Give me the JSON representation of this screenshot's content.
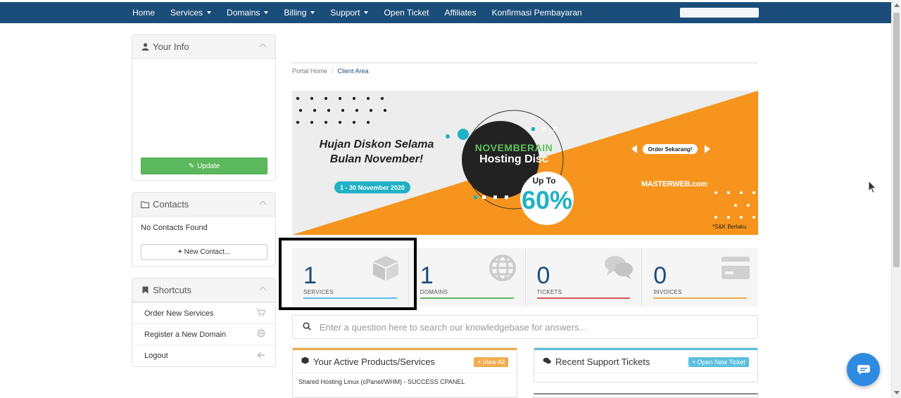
{
  "nav": {
    "items": [
      {
        "label": "Home",
        "dropdown": false
      },
      {
        "label": "Services",
        "dropdown": true
      },
      {
        "label": "Domains",
        "dropdown": true
      },
      {
        "label": "Billing",
        "dropdown": true
      },
      {
        "label": "Support",
        "dropdown": true
      },
      {
        "label": "Open Ticket",
        "dropdown": false
      },
      {
        "label": "Affiliates",
        "dropdown": false
      },
      {
        "label": "Konfirmasi Pembayaran",
        "dropdown": false
      }
    ]
  },
  "sidebar": {
    "your_info": {
      "title": "Your Info",
      "icon": "user-icon",
      "update_label": "Update"
    },
    "contacts": {
      "title": "Contacts",
      "icon": "folder-icon",
      "empty_text": "No Contacts Found",
      "new_label": "New Contact..."
    },
    "shortcuts": {
      "title": "Shortcuts",
      "icon": "bookmark-icon",
      "items": [
        {
          "label": "Order New Services",
          "icon": "cart-icon"
        },
        {
          "label": "Register a New Domain",
          "icon": "globe-icon"
        },
        {
          "label": "Logout",
          "icon": "arrow-left-icon"
        }
      ]
    }
  },
  "breadcrumb": {
    "home": "Portal Home",
    "separator": "/",
    "current": "Client Area"
  },
  "banner": {
    "headline_line1": "Hujan Diskon Selama",
    "headline_line2": "Bulan November!",
    "date_range": "1 - 30 November 2020",
    "promo_title": "NOVEMBERAIN",
    "promo_subtitle": "Hosting Disc",
    "up_to": "Up To",
    "discount": "60%",
    "order_label": "Order Sekarang!",
    "brand": "MASTERWEB.com",
    "terms": "*S&K Berlaku",
    "colors": {
      "orange": "#f7941d",
      "teal": "#1fb1c4",
      "green": "#5ec15f",
      "dark": "#222222"
    }
  },
  "stats": [
    {
      "value": "1",
      "label": "SERVICES",
      "color": "#5bc0de",
      "icon": "cube-icon"
    },
    {
      "value": "1",
      "label": "DOMAINS",
      "color": "#5cb85c",
      "icon": "globe-icon"
    },
    {
      "value": "0",
      "label": "TICKETS",
      "color": "#d9534f",
      "icon": "comments-icon"
    },
    {
      "value": "0",
      "label": "INVOICES",
      "color": "#f0ad4e",
      "icon": "credit-card-icon"
    }
  ],
  "search": {
    "placeholder": "Enter a question here to search our knowledgebase for answers..."
  },
  "products_card": {
    "title": "Your Active Products/Services",
    "button": "View All",
    "rows": [
      "Shared Hosting Linux (cPanel/WHM) - SUCCESS CPANEL"
    ]
  },
  "tickets_card": {
    "title": "Recent Support Tickets",
    "button": "Open New Ticket"
  },
  "colors": {
    "nav_bg": "#1a4d7a",
    "accent_blue": "#1a4d7a",
    "green_button": "#5cb85c",
    "chat_button": "#2e8be0"
  }
}
